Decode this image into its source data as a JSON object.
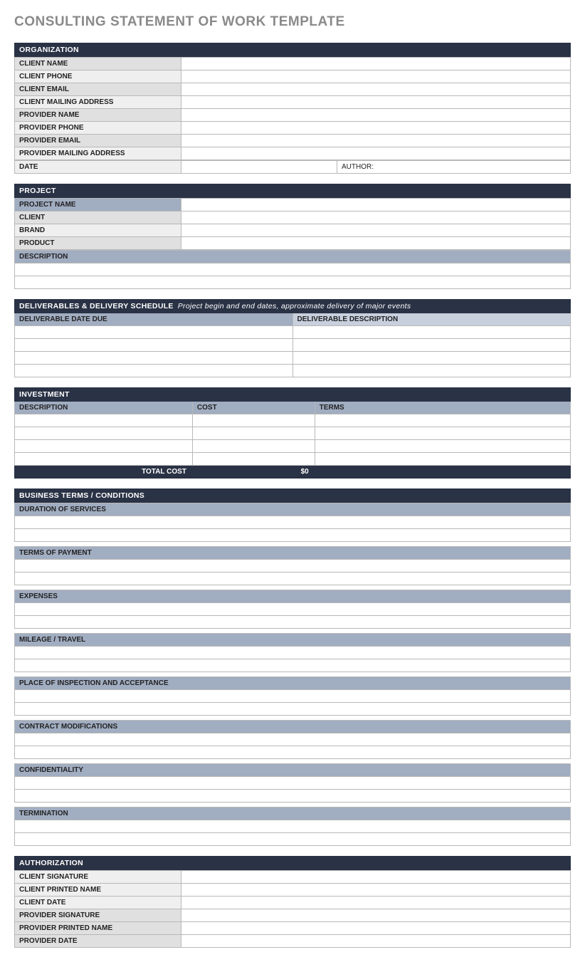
{
  "title": "CONSULTING STATEMENT OF WORK TEMPLATE",
  "organization": {
    "header": "ORGANIZATION",
    "rows": [
      {
        "label": "CLIENT NAME",
        "shade": "shade-light"
      },
      {
        "label": "CLIENT  PHONE",
        "shade": "shade-lighter"
      },
      {
        "label": "CLIENT EMAIL",
        "shade": "shade-light"
      },
      {
        "label": "CLIENT MAILING ADDRESS",
        "shade": "shade-lighter"
      },
      {
        "label": "PROVIDER NAME",
        "shade": "shade-light"
      },
      {
        "label": "PROVIDER PHONE",
        "shade": "shade-lighter"
      },
      {
        "label": "PROVIDER EMAIL",
        "shade": "shade-light"
      },
      {
        "label": "PROVIDER MAILING ADDRESS",
        "shade": "shade-lighter"
      }
    ],
    "dateLabel": "DATE",
    "authorLabel": "AUTHOR:"
  },
  "project": {
    "header": "PROJECT",
    "rows": [
      {
        "label": "PROJECT NAME",
        "shade": "shade-blue"
      },
      {
        "label": "CLIENT",
        "shade": "shade-light"
      },
      {
        "label": "BRAND",
        "shade": "shade-lighter"
      },
      {
        "label": "PRODUCT",
        "shade": "shade-light"
      }
    ],
    "descLabel": "DESCRIPTION"
  },
  "deliverables": {
    "header": "DELIVERABLES & DELIVERY SCHEDULE",
    "sub": "Project begin and end dates, approximate delivery of major events",
    "col1": "DELIVERABLE DATE DUE",
    "col2": "DELIVERABLE DESCRIPTION"
  },
  "investment": {
    "header": "INVESTMENT",
    "col1": "DESCRIPTION",
    "col2": "COST",
    "col3": "TERMS",
    "totalLabel": "TOTAL COST",
    "totalValue": "$0"
  },
  "terms": {
    "header": "BUSINESS TERMS / CONDITIONS",
    "items": [
      "DURATION OF SERVICES",
      "TERMS OF PAYMENT",
      "EXPENSES",
      "MILEAGE / TRAVEL",
      "PLACE OF INSPECTION AND ACCEPTANCE",
      "CONTRACT MODIFICATIONS",
      "CONFIDENTIALITY",
      "TERMINATION"
    ]
  },
  "authorization": {
    "header": "AUTHORIZATION",
    "rows": [
      {
        "label": "CLIENT SIGNATURE",
        "shade": "shade-lighter"
      },
      {
        "label": "CLIENT PRINTED NAME",
        "shade": "shade-lighter"
      },
      {
        "label": "CLIENT DATE",
        "shade": "shade-lighter"
      },
      {
        "label": "PROVIDER SIGNATURE",
        "shade": "shade-light"
      },
      {
        "label": "PROVIDER PRINTED NAME",
        "shade": "shade-light"
      },
      {
        "label": "PROVIDER DATE",
        "shade": "shade-light"
      }
    ]
  }
}
